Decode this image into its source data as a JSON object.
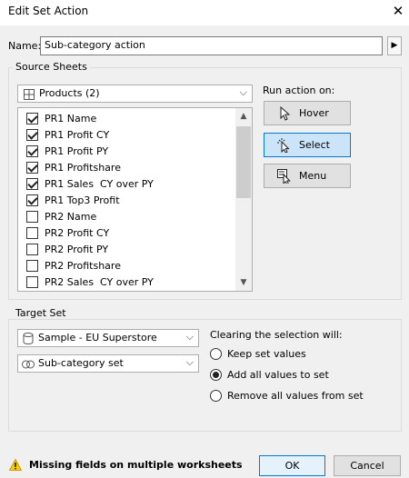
{
  "dialog": {
    "title": "Edit Set Action"
  },
  "name": {
    "label": "Name:",
    "value": "Sub-category action"
  },
  "source_sheets": {
    "group_label": "Source Sheets",
    "dropdown_value": "Products (2)",
    "sheets": [
      {
        "label": "PR1 Name",
        "checked": true
      },
      {
        "label": "PR1 Profit CY",
        "checked": true
      },
      {
        "label": "PR1 Profit PY",
        "checked": true
      },
      {
        "label": "PR1 Profitshare",
        "checked": true
      },
      {
        "label": "PR1 Sales  CY over PY",
        "checked": true
      },
      {
        "label": "PR1 Top3 Profit",
        "checked": true
      },
      {
        "label": "PR2 Name",
        "checked": false
      },
      {
        "label": "PR2 Profit CY",
        "checked": false
      },
      {
        "label": "PR2 Profit PY",
        "checked": false
      },
      {
        "label": "PR2 Profitshare",
        "checked": false
      },
      {
        "label": "PR2 Sales  CY over PY",
        "checked": false
      }
    ]
  },
  "run_action": {
    "label": "Run action on:",
    "options": [
      {
        "label": "Hover",
        "icon": "pointer-icon",
        "selected": false
      },
      {
        "label": "Select",
        "icon": "select-pointer-icon",
        "selected": true
      },
      {
        "label": "Menu",
        "icon": "menu-pointer-icon",
        "selected": false
      }
    ]
  },
  "target_set": {
    "group_label": "Target Set",
    "data_source": "Sample - EU Superstore",
    "set": "Sub-category set",
    "clearing_label": "Clearing the selection will:",
    "clearing_options": [
      {
        "label": "Keep set values",
        "selected": false
      },
      {
        "label": "Add all values to set",
        "selected": true
      },
      {
        "label": "Remove all values from set",
        "selected": false
      }
    ]
  },
  "footer": {
    "warning": "Missing fields on multiple worksheets",
    "ok_label": "OK",
    "cancel_label": "Cancel"
  }
}
